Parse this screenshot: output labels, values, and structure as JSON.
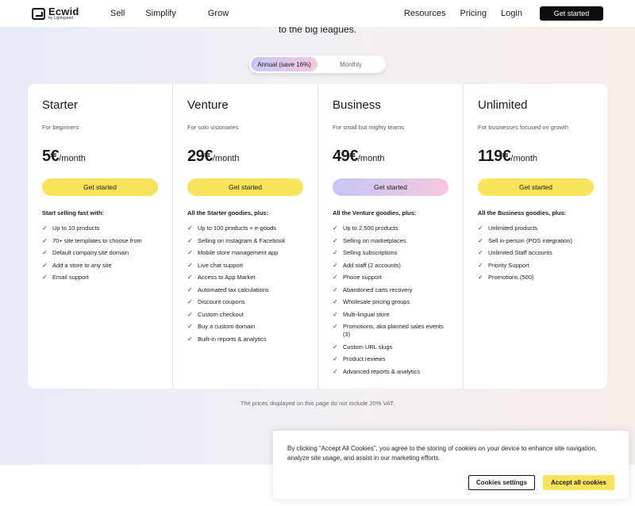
{
  "header": {
    "logo_name": "Ecwid",
    "logo_sub": "by Lightspeed",
    "nav_left": [
      "Sell",
      "Simplify",
      "Grow"
    ],
    "nav_right": [
      "Resources",
      "Pricing",
      "Login"
    ],
    "cta": "Get started"
  },
  "tagline": "to the big leagues.",
  "billing_toggle": {
    "options": [
      "Annual (save 16%)",
      "Monthly"
    ],
    "selected": "Annual (save 16%)"
  },
  "plans": [
    {
      "name": "Starter",
      "description": "For beginners",
      "price": "5€",
      "period": "/month",
      "button": "Get started",
      "features_title": "Start selling fast with:",
      "features": [
        "Up to 10 products",
        "70+ site templates to choose from",
        "Default company.site domain",
        "Add a store to any site",
        "Email support"
      ]
    },
    {
      "name": "Venture",
      "description": "For solo visionaries",
      "price": "29€",
      "period": "/month",
      "button": "Get started",
      "features_title": "All the Starter goodies, plus:",
      "features": [
        "Up to 100 products + e-goods",
        "Selling on Instagram & Facebook",
        "Mobile store management app",
        "Live chat support",
        "Access to App Market",
        "Automated tax calculations",
        "Discount coupons",
        "Custom checkout",
        "Buy a custom domain",
        "Built-in reports & analytics"
      ]
    },
    {
      "name": "Business",
      "description": "For small but mighty teams",
      "price": "49€",
      "period": "/month",
      "button": "Get started",
      "features_title": "All the Venture goodies, plus:",
      "features": [
        "Up to 2,500 products",
        "Selling on marketplaces",
        "Selling subscriptions",
        "Add staff (2 accounts)",
        "Phone support",
        "Abandoned carts recovery",
        "Wholesale pricing groups",
        "Multi-lingual store",
        "Promotions, aka planned sales events (3)",
        "Custom URL slugs",
        "Product reviews",
        "Advanced reports & analytics"
      ]
    },
    {
      "name": "Unlimited",
      "description": "For businesses focused on growth",
      "price": "119€",
      "period": "/month",
      "button": "Get started",
      "features_title": "All the Business goodies, plus:",
      "features": [
        "Unlimited products",
        "Sell in-person (POS integration)",
        "Unlimited Staff accounts",
        "Priority Support",
        "Promotions (500)"
      ]
    }
  ],
  "vat_note": "The prices displayed on this page do not include 20% VAT.",
  "cookie_banner": {
    "text": "By clicking “Accept All Cookies”, you agree to the storing of cookies on your device to enhance site navigation, analyze site usage, and assist in our marketing efforts.",
    "settings_button": "Cookies settings",
    "accept_button": "Accept all cookies"
  },
  "colors": {
    "accent_yellow": "#f9e35a",
    "header_button": "#0d0d0d",
    "gradient_start": "#c3c7f7",
    "gradient_end": "#f7c7dd"
  }
}
